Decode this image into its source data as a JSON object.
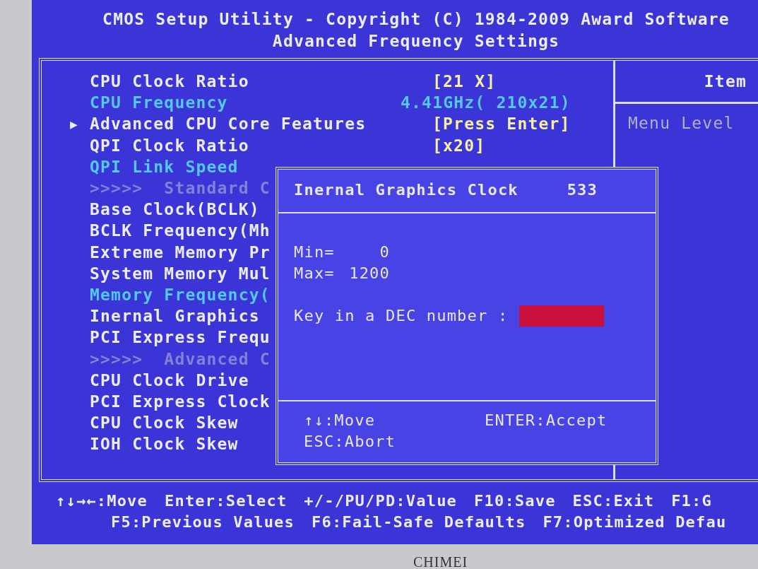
{
  "header": {
    "title": "CMOS Setup Utility - Copyright (C) 1984-2009 Award Software",
    "subtitle": "Advanced Frequency Settings"
  },
  "menu": [
    {
      "kind": "setting",
      "label": "CPU Clock Ratio",
      "value": "[21 X]"
    },
    {
      "kind": "info",
      "label": "CPU Frequency",
      "value": "4.41GHz( 210x21)"
    },
    {
      "kind": "submenu",
      "label": "Advanced CPU Core Features",
      "value": "[Press Enter]",
      "marker": "▶"
    },
    {
      "kind": "setting",
      "label": "QPI Clock Ratio",
      "value": "[x20]"
    },
    {
      "kind": "info",
      "label": "QPI Link Speed"
    },
    {
      "kind": "header",
      "label": ">>>>>  Standard C"
    },
    {
      "kind": "setting",
      "label": "Base Clock(BCLK)"
    },
    {
      "kind": "setting",
      "label": "BCLK Frequency(Mh"
    },
    {
      "kind": "setting",
      "label": "Extreme Memory Pr"
    },
    {
      "kind": "setting",
      "label": "System Memory Mul"
    },
    {
      "kind": "info",
      "label": "Memory Frequency("
    },
    {
      "kind": "setting",
      "label": "Inernal Graphics"
    },
    {
      "kind": "setting",
      "label": "PCI Express Frequ"
    },
    {
      "kind": "header",
      "label": ">>>>>  Advanced C"
    },
    {
      "kind": "setting",
      "label": "CPU Clock Drive"
    },
    {
      "kind": "setting",
      "label": "PCI Express Clock"
    },
    {
      "kind": "setting",
      "label": "CPU Clock Skew"
    },
    {
      "kind": "setting",
      "label": "IOH Clock Skew"
    }
  ],
  "help_panel": {
    "title": "Item",
    "menu_level": "Menu Level"
  },
  "dialog": {
    "title": "Inernal Graphics Clock",
    "current": "533",
    "min_label": "Min=",
    "min": "0",
    "max_label": "Max=",
    "max": "1200",
    "prompt": "Key in a DEC number :",
    "keys": [
      {
        "label": "↑↓:Move"
      },
      {
        "label": "ENTER:Accept"
      },
      {
        "label": "ESC:Abort"
      }
    ]
  },
  "key_bar": [
    [
      "↑↓→←:Move",
      "Enter:Select",
      "+/-/PU/PD:Value",
      "F10:Save",
      "ESC:Exit",
      "F1:G"
    ],
    [
      "F5:Previous Values",
      "F6:Fail-Safe Defaults",
      "F7:Optimized Defau"
    ]
  ],
  "bezel_label": "CHIMEI"
}
